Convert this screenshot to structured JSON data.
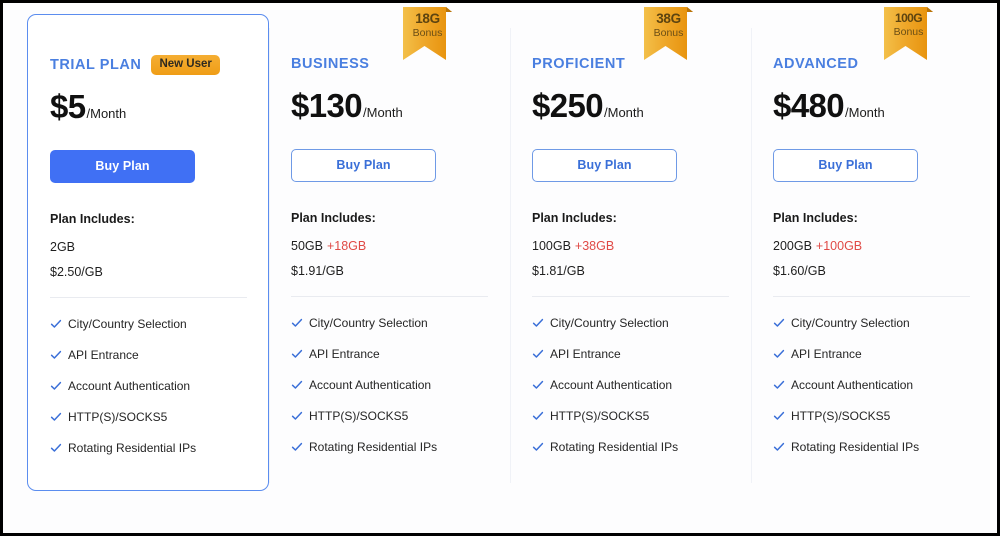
{
  "page": {
    "includes_label": "Plan Includes:",
    "per_month_suffix": "/Month",
    "check_icon": "check-icon",
    "ribbon_label": "Bonus",
    "accent_blue": "#4070f4",
    "plan_name_blue": "#4a7fe0",
    "bonus_red": "#e04a46",
    "badge_orange": "#ef9d16"
  },
  "plans": [
    {
      "name": "TRIAL PLAN",
      "badge": "New User",
      "has_badge": true,
      "price": "$5",
      "per": "/Month",
      "button": "Buy Plan",
      "button_style": "filled",
      "quota": "2GB",
      "bonus": "",
      "rate": "$2.50/GB",
      "ribbon": null,
      "featured": true,
      "features": [
        "City/Country Selection",
        "API Entrance",
        "Account Authentication",
        "HTTP(S)/SOCKS5",
        "Rotating Residential IPs"
      ]
    },
    {
      "name": "BUSINESS",
      "badge": "",
      "has_badge": false,
      "price": "$130",
      "per": "/Month",
      "button": "Buy Plan",
      "button_style": "outline",
      "quota": "50GB",
      "bonus": "+18GB",
      "rate": "$1.91/GB",
      "ribbon": {
        "amount": "18G",
        "label": "Bonus"
      },
      "featured": false,
      "features": [
        "City/Country Selection",
        "API Entrance",
        "Account Authentication",
        "HTTP(S)/SOCKS5",
        "Rotating Residential IPs"
      ]
    },
    {
      "name": "PROFICIENT",
      "badge": "",
      "has_badge": false,
      "price": "$250",
      "per": "/Month",
      "button": "Buy Plan",
      "button_style": "outline",
      "quota": "100GB",
      "bonus": "+38GB",
      "rate": "$1.81/GB",
      "ribbon": {
        "amount": "38G",
        "label": "Bonus"
      },
      "featured": false,
      "features": [
        "City/Country Selection",
        "API Entrance",
        "Account Authentication",
        "HTTP(S)/SOCKS5",
        "Rotating Residential IPs"
      ]
    },
    {
      "name": "ADVANCED",
      "badge": "",
      "has_badge": false,
      "price": "$480",
      "per": "/Month",
      "button": "Buy Plan",
      "button_style": "outline",
      "quota": "200GB",
      "bonus": "+100GB",
      "rate": "$1.60/GB",
      "ribbon": {
        "amount": "100G",
        "label": "Bonus"
      },
      "featured": false,
      "features": [
        "City/Country Selection",
        "API Entrance",
        "Account Authentication",
        "HTTP(S)/SOCKS5",
        "Rotating Residential IPs"
      ]
    }
  ]
}
